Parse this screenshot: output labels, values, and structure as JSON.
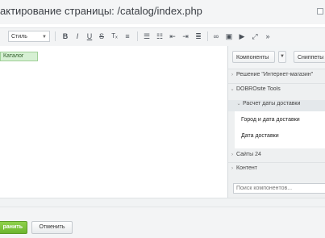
{
  "header": {
    "title": "актирование страницы: /catalog/index.php"
  },
  "toolbar": {
    "style_select": "Стиль",
    "buttons": [
      {
        "name": "bold-icon",
        "glyph": "B"
      },
      {
        "name": "italic-icon",
        "glyph": "I"
      },
      {
        "name": "underline-icon",
        "glyph": "U"
      },
      {
        "name": "strikethrough-icon",
        "glyph": "S"
      },
      {
        "name": "clear-format-icon",
        "glyph": "Tx"
      },
      {
        "name": "align-left-icon",
        "glyph": "≡"
      },
      {
        "name": "ordered-list-icon",
        "glyph": "☰"
      },
      {
        "name": "unordered-list-icon",
        "glyph": "☷"
      },
      {
        "name": "indent-left-icon",
        "glyph": "⇤"
      },
      {
        "name": "indent-right-icon",
        "glyph": "⇥"
      },
      {
        "name": "align-justify-icon",
        "glyph": "≣"
      },
      {
        "name": "link-icon",
        "glyph": "∞"
      },
      {
        "name": "image-icon",
        "glyph": "▣"
      },
      {
        "name": "video-icon",
        "glyph": "▶"
      },
      {
        "name": "fullscreen-icon",
        "glyph": "⤢"
      },
      {
        "name": "more-icon",
        "glyph": "»"
      }
    ]
  },
  "editor": {
    "catalog_chip": "Каталог"
  },
  "panel": {
    "tabs": {
      "components": "Компоненты",
      "snippets": "Сниппеты"
    },
    "tree": {
      "solution": "Решение \"Интернет-магазин\"",
      "dobrosite": "DOBROsite Tools",
      "delivery_calc": "Расчет даты доставки",
      "item_city": "Город и дата доставки",
      "item_date": "Дата доставки",
      "sites24": "Сайты 24",
      "content": "Контент"
    },
    "search_placeholder": "Поиск компонентов..."
  },
  "footer": {
    "save_label": "ранить",
    "cancel_label": "Отменить"
  },
  "colors": {
    "save_green": "#6db52f",
    "chip_green": "#d6f0d3"
  }
}
